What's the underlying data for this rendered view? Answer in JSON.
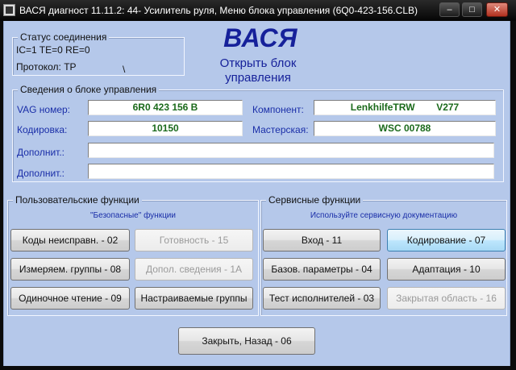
{
  "window": {
    "title": "ВАСЯ диагност 11.11.2: 44- Усилитель руля,  Меню блока управления (6Q0-423-156.CLB)",
    "minimize_glyph": "‒",
    "maximize_glyph": "□",
    "close_glyph": "✕"
  },
  "status": {
    "group_title": "Статус соединения",
    "line1": "IC=1  TE=0  RE=0",
    "protocol": "Протокол: TP",
    "spinner": "\\"
  },
  "header": {
    "logo": "ВАСЯ",
    "open_block": "Открыть блок управления"
  },
  "info": {
    "group_title": "Сведения о блоке управления",
    "vag_label": "VAG номер:",
    "vag_value": "6R0 423 156 B",
    "component_label": "Компонент:",
    "component_value": "LenkhilfeTRW        V277",
    "coding_label": "Кодировка:",
    "coding_value": "10150",
    "workshop_label": "Мастерская:",
    "workshop_value": "WSC 00788",
    "extra1_label": "Дополнит.:",
    "extra1_value": "",
    "extra2_label": "Дополнит.:",
    "extra2_value": ""
  },
  "user_functions": {
    "group_title": "Пользовательские функции",
    "subtitle": "\"Безопасные\" функции",
    "fault_codes": "Коды неисправн. - 02",
    "readiness": "Готовность - 15",
    "meas_groups": "Измеряем. группы - 08",
    "extra_info": "Допол. сведения - 1A",
    "single_read": "Одиночное чтение - 09",
    "custom_groups": "Настраиваемые группы"
  },
  "service_functions": {
    "group_title": "Сервисные функции",
    "subtitle": "Используйте сервисную документацию",
    "login": "Вход - 11",
    "coding": "Кодирование - 07",
    "basic_settings": "Базов. параметры - 04",
    "adaptation": "Адаптация - 10",
    "output_test": "Тест исполнителей - 03",
    "security_access": "Закрытая область - 16"
  },
  "footer": {
    "close_back": "Закрыть, Назад - 06"
  }
}
